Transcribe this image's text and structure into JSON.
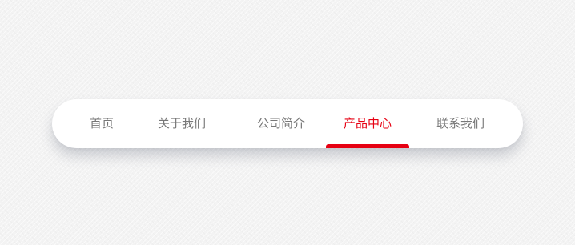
{
  "nav": {
    "items": [
      {
        "label": "首页",
        "active": false
      },
      {
        "label": "关于我们",
        "active": false
      },
      {
        "label": "公司简介",
        "active": false
      },
      {
        "label": "产品中心",
        "active": true
      },
      {
        "label": "联系我们",
        "active": false
      }
    ]
  },
  "colors": {
    "active": "#e60012",
    "inactive": "#777777",
    "bar_background": "#ffffff",
    "page_background": "#f3f3f3"
  }
}
